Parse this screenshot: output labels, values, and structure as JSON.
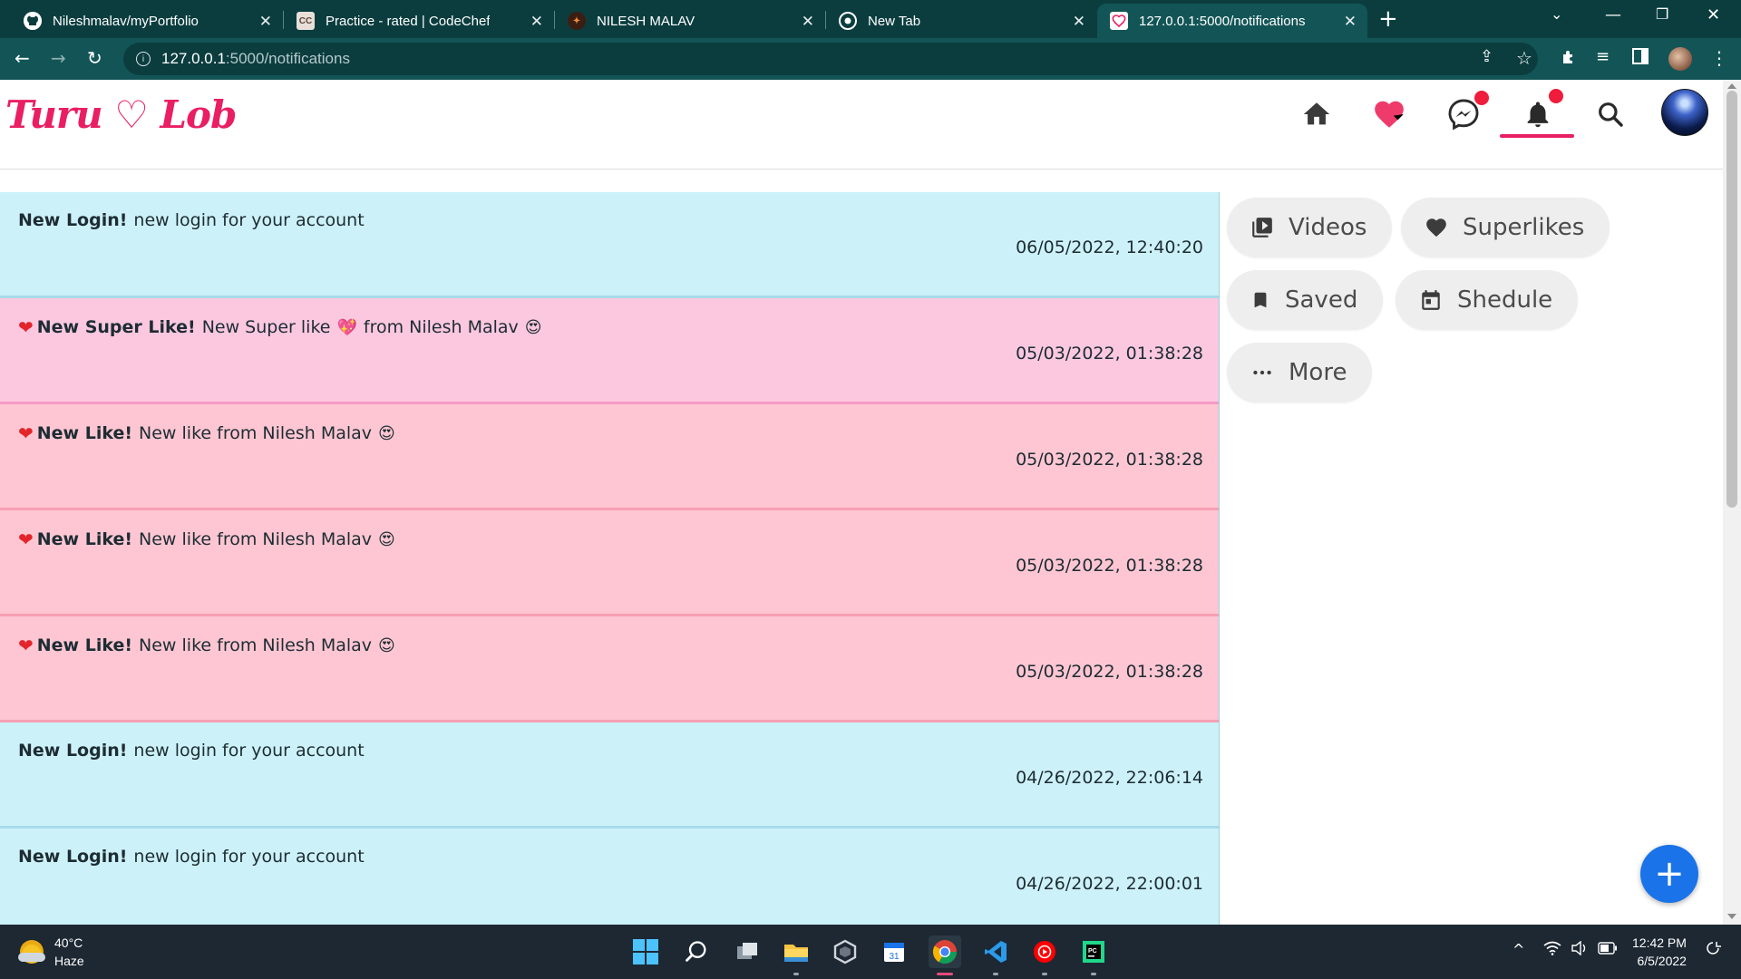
{
  "browser": {
    "tabs": [
      {
        "title": "Nileshmalav/myPortfolio",
        "icon": "github-icon"
      },
      {
        "title": "Practice - rated | CodeChef",
        "icon": "codechef-icon"
      },
      {
        "title": "NILESH MALAV",
        "icon": "portfolio-icon"
      },
      {
        "title": "New Tab",
        "icon": "chrome-icon"
      },
      {
        "title": "127.0.0.1:5000/notifications",
        "icon": "heart-icon",
        "active": true
      }
    ],
    "close_glyph": "✕",
    "new_tab_glyph": "+",
    "url_host": "127.0.0.1",
    "url_path": ":5000/notifications"
  },
  "site": {
    "logo": "Turu ♡ Lob",
    "accent_color": "#e91e63",
    "nav": [
      "home-icon",
      "superlikes-icon",
      "messenger-icon",
      "notifications-icon",
      "search-icon",
      "profile-avatar"
    ],
    "active_nav": "notifications-icon"
  },
  "notifications": [
    {
      "type": "login",
      "title": "New Login!",
      "message": "new login for your account",
      "time": "06/05/2022, 12:40:20"
    },
    {
      "type": "superlike",
      "title": "New Super Like!",
      "message": "New Super like",
      "emoji1": "💖",
      "message2": "from Nilesh Malav",
      "emoji2": "😍",
      "time": "05/03/2022, 01:38:28"
    },
    {
      "type": "like",
      "title": "New Like!",
      "message": "New like from Nilesh Malav",
      "emoji": "😍",
      "time": "05/03/2022, 01:38:28"
    },
    {
      "type": "like",
      "title": "New Like!",
      "message": "New like from Nilesh Malav",
      "emoji": "😍",
      "time": "05/03/2022, 01:38:28"
    },
    {
      "type": "like",
      "title": "New Like!",
      "message": "New like from Nilesh Malav",
      "emoji": "😍",
      "time": "05/03/2022, 01:38:28"
    },
    {
      "type": "login",
      "title": "New Login!",
      "message": "new login for your account",
      "time": "04/26/2022, 22:06:14"
    },
    {
      "type": "login",
      "title": "New Login!",
      "message": "new login for your account",
      "time": "04/26/2022, 22:00:01"
    }
  ],
  "sidebar": {
    "buttons": [
      {
        "label": "Videos",
        "icon": "video-library-icon"
      },
      {
        "label": "Superlikes",
        "icon": "heart-icon"
      },
      {
        "label": "Saved",
        "icon": "bookmark-icon"
      },
      {
        "label": "Shedule",
        "icon": "calendar-icon"
      },
      {
        "label": "More",
        "icon": "more-horizontal-icon"
      }
    ]
  },
  "fab": {
    "label": "+"
  },
  "taskbar": {
    "weather_temp": "40°C",
    "weather_condition": "Haze",
    "time": "12:42 PM",
    "date": "6/5/2022"
  }
}
